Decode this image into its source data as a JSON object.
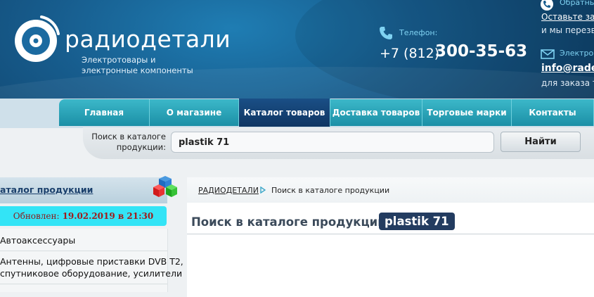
{
  "header": {
    "logo_text": "радиодетали",
    "logo_subtitle_1": "Электротовары и",
    "logo_subtitle_2": "электронные компоненты",
    "phone": {
      "label": "Телефон:",
      "code": "+7 (812)",
      "number": "300-35-63"
    },
    "callback": {
      "label": "Обратны",
      "link": "Оставьте зая",
      "text": "и мы перезв"
    },
    "email": {
      "label": "Электрон",
      "link": "info@rade",
      "text": "для заказа т"
    }
  },
  "nav": {
    "items": [
      {
        "label": "Главная",
        "active": false
      },
      {
        "label": "О магазине",
        "active": false
      },
      {
        "label": "Каталог товаров",
        "active": true
      },
      {
        "label": "Доставка товаров",
        "active": false
      },
      {
        "label": "Торговые марки",
        "active": false
      },
      {
        "label": "Контакты",
        "active": false
      }
    ]
  },
  "search": {
    "label_1": "Поиск в каталоге",
    "label_2": "продукции:",
    "value": "plastik 71",
    "button": "Найти"
  },
  "sidebar": {
    "title": "аталог продукции",
    "updated_label": "Обновлен:",
    "updated_value": "19.02.2019 в 21:30",
    "items": [
      "Автоаксессуары",
      "Антенны, цифровые приставки DVB T2,",
      "спутниковое оборудование, усилители"
    ]
  },
  "main": {
    "breadcrumb_root": "РАДИОДЕТАЛИ",
    "breadcrumb_current": "Поиск в каталоге продукции",
    "page_title": "Поиск в каталоге продукции:",
    "query": "plastik 71"
  },
  "colors": {
    "header_blue": "#175d8e",
    "nav_teal": "#1b8fa6",
    "nav_active": "#0f3562",
    "updated_bg": "#33e4f6",
    "badge_bg": "#233c60"
  }
}
